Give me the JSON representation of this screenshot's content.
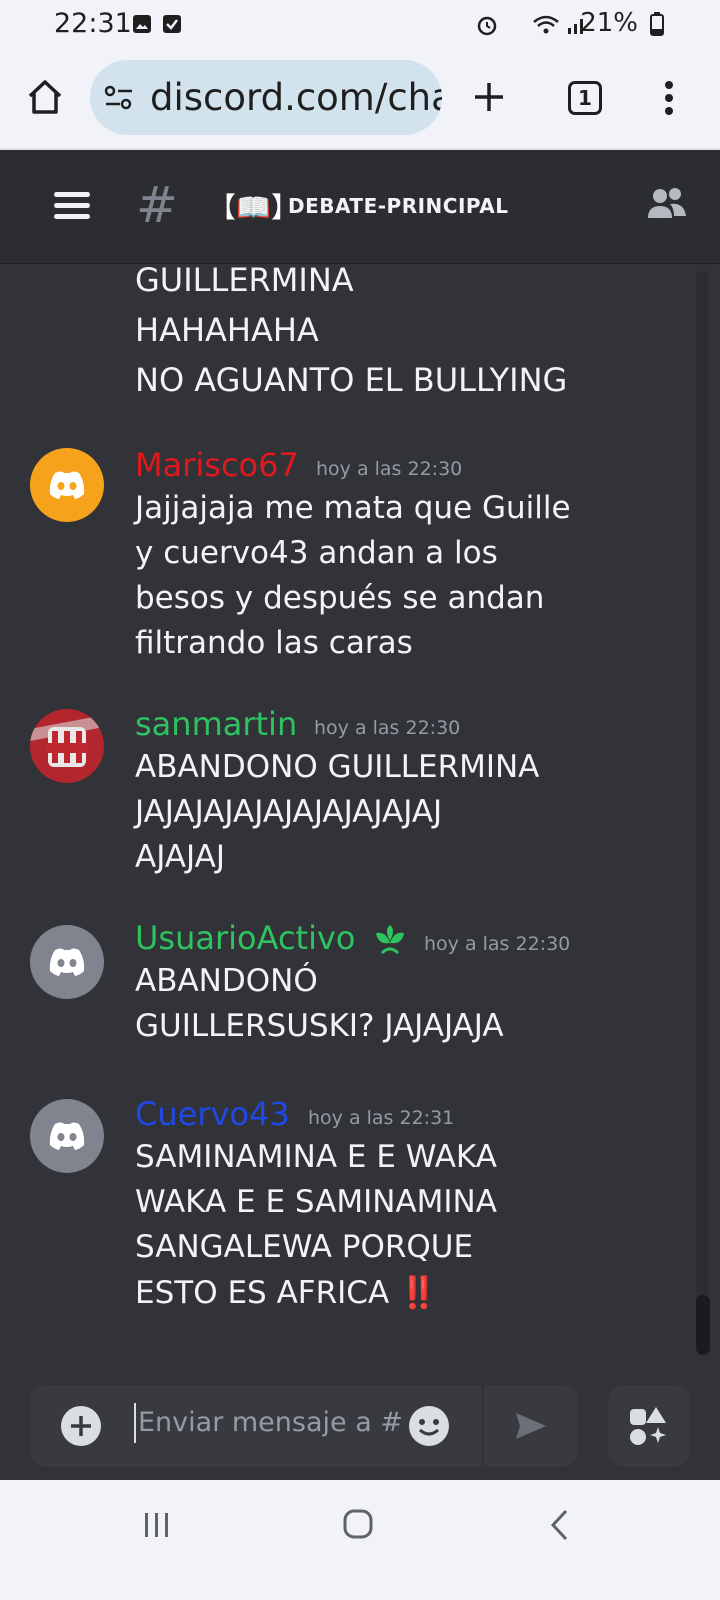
{
  "status_bar": {
    "time": "22:31",
    "battery": "21%",
    "icons": [
      "image-icon",
      "checkbox-icon",
      "alarm-icon",
      "wifi-icon",
      "signal-icon",
      "battery-icon"
    ]
  },
  "browser": {
    "url": "discord.com/cha",
    "tab_count": "1"
  },
  "channel": {
    "book_emoji": "【📖】",
    "name": "DEBATE-PRINCIPAL"
  },
  "messages": {
    "continued": [
      "GUILLERMINA",
      "HAHAHAHA",
      "NO AGUANTO EL BULLYING"
    ],
    "m1": {
      "author": "Marisco67",
      "author_color": "#e0191c",
      "timestamp": "hoy a las 22:30",
      "lines": [
        "Jajjajaja me mata que Guille",
        "y cuervo43 andan a los",
        "besos y después se andan",
        "filtrando las caras"
      ]
    },
    "m2": {
      "author": "sanmartin",
      "author_color": "#2ec35f",
      "timestamp": "hoy a las 22:30",
      "lines": [
        "ABANDONO GUILLERMINA",
        "JAJAJAJAJAJAJAJAJAJAJ",
        "AJAJAJ"
      ]
    },
    "m3": {
      "author": "UsuarioActivo",
      "author_color": "#2ec35f",
      "timestamp": "hoy a las 22:30",
      "lines": [
        "ABANDONÓ",
        "GUILLERSUSKI? JAJAJAJA"
      ]
    },
    "m4": {
      "author": "Cuervo43",
      "author_color": "#1f49e6",
      "timestamp": "hoy a las 22:31",
      "lines": [
        "SAMINAMINA E E WAKA",
        "WAKA E E SAMINAMINA",
        "SANGALEWA PORQUE",
        "ESTO ES AFRICA"
      ],
      "emoji": "‼️"
    }
  },
  "composer": {
    "placeholder": "Enviar mensaje a #"
  },
  "colors": {
    "background": "#313338",
    "header": "#2b2d31",
    "timestamp": "#949ba4",
    "avatar_orange": "#f6a31b",
    "avatar_gray": "#80848e"
  }
}
